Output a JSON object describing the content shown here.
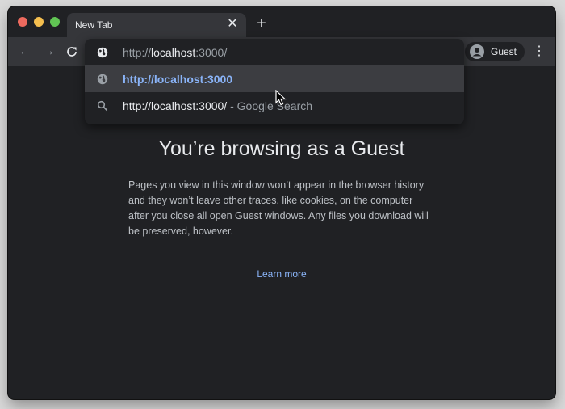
{
  "tab": {
    "title": "New Tab"
  },
  "omnibox": {
    "input": {
      "prefix": "http://",
      "host": "localhost",
      "suffix": ":3000/"
    },
    "suggestions": [
      {
        "text": "http://localhost:3000"
      },
      {
        "main": "http://localhost:3000/",
        "secondary": " - Google Search"
      }
    ]
  },
  "profile": {
    "label": "Guest"
  },
  "page": {
    "heading": "You’re browsing as a Guest",
    "body": "Pages you view in this window won’t appear in the browser history and they won’t leave other traces, like cookies, on the computer after you close all open Guest windows. Any files you download will be preserved, however.",
    "link": "Learn more"
  },
  "icons": {
    "close": "close-icon",
    "new_tab": "plus-icon",
    "back": "arrow-left-icon",
    "forward": "arrow-right-icon",
    "reload": "reload-icon",
    "globe": "globe-icon",
    "search": "search-icon",
    "avatar": "avatar-icon",
    "menu": "more-vert-icon",
    "cursor": "mouse-pointer-icon"
  },
  "colors": {
    "window_bg": "#202124",
    "toolbar_bg": "#35363a",
    "link": "#8ab4f8",
    "text": "#e8eaed"
  }
}
